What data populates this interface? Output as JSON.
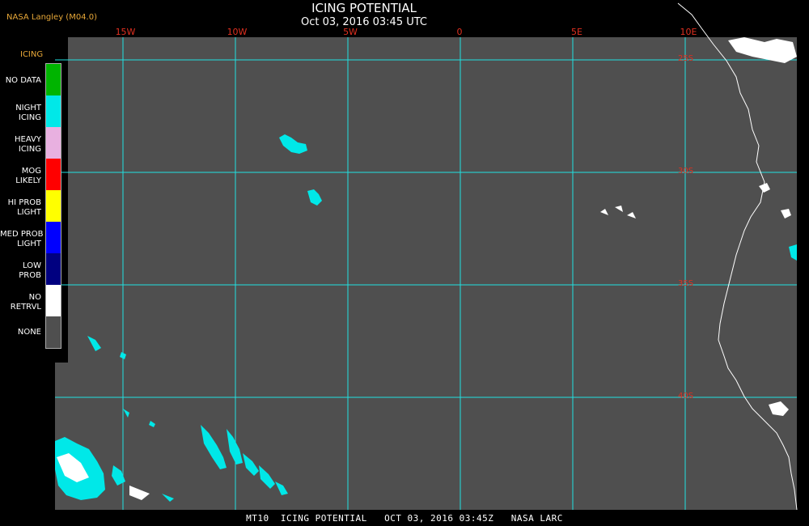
{
  "header": {
    "credit": "NASA Langley (M04.0)",
    "title": "ICING POTENTIAL",
    "subtitle": "Oct 03, 2016 03:45 UTC"
  },
  "map": {
    "background_color": "#4f4f4f",
    "grid_color": "#20e0e0",
    "coast_color": "#ffffff",
    "lon_labels": [
      "15W",
      "10W",
      "5W",
      "0",
      "5E",
      "10E"
    ],
    "lat_labels": [
      "25S",
      "30S",
      "35S",
      "40S"
    ]
  },
  "legend": {
    "title": "ICING",
    "items": [
      {
        "label": "NO DATA",
        "color": "#00b400"
      },
      {
        "label": "NIGHT\nICING",
        "color": "#00e8e8"
      },
      {
        "label": "HEAVY\nICING",
        "color": "#e8b0e0"
      },
      {
        "label": "MOG\nLIKELY",
        "color": "#ff0000"
      },
      {
        "label": "HI PROB\nLIGHT",
        "color": "#ffff00"
      },
      {
        "label": "MED PROB\nLIGHT",
        "color": "#0000ff"
      },
      {
        "label": "LOW\nPROB",
        "color": "#000080"
      },
      {
        "label": "NO\nRETRVL",
        "color": "#ffffff"
      },
      {
        "label": "NONE",
        "color": "#4f4f4f"
      }
    ]
  },
  "footer": {
    "text": "MT10  ICING POTENTIAL   OCT 03, 2016 03:45Z   NASA LARC"
  }
}
